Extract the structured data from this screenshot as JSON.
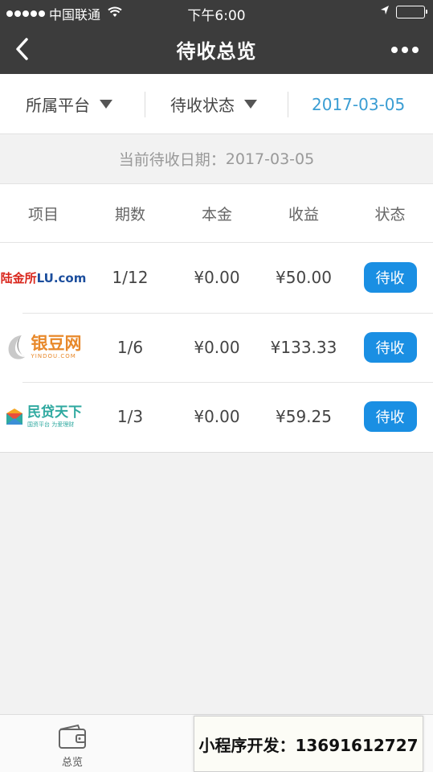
{
  "status_bar": {
    "carrier": "中国联通",
    "time": "下午6:00"
  },
  "nav": {
    "title": "待收总览"
  },
  "filters": {
    "platform": "所属平台",
    "status": "待收状态",
    "date": "2017-03-05"
  },
  "date_banner": {
    "label": "当前待收日期：",
    "value": "2017-03-05"
  },
  "table": {
    "headers": [
      "项目",
      "期数",
      "本金",
      "收益",
      "状态"
    ],
    "rows": [
      {
        "logo": {
          "cn": "陆金所",
          "en": "LU.com"
        },
        "period": "1/12",
        "principal": "¥0.00",
        "income": "¥50.00",
        "status": "待收"
      },
      {
        "logo": {
          "cn": "银豆网",
          "en": "YINDOU.COM"
        },
        "period": "1/6",
        "principal": "¥0.00",
        "income": "¥133.33",
        "status": "待收"
      },
      {
        "logo": {
          "cn": "民贷天下",
          "en": "国资平台 为爱理财"
        },
        "period": "1/3",
        "principal": "¥0.00",
        "income": "¥59.25",
        "status": "待收"
      }
    ]
  },
  "tabbar": {
    "home_label": "总览"
  },
  "promo": {
    "text": "小程序开发：13691612727"
  },
  "colors": {
    "nav_bg": "#3c3c3c",
    "accent": "#1a8fe3",
    "date_link": "#3a9dd3"
  }
}
